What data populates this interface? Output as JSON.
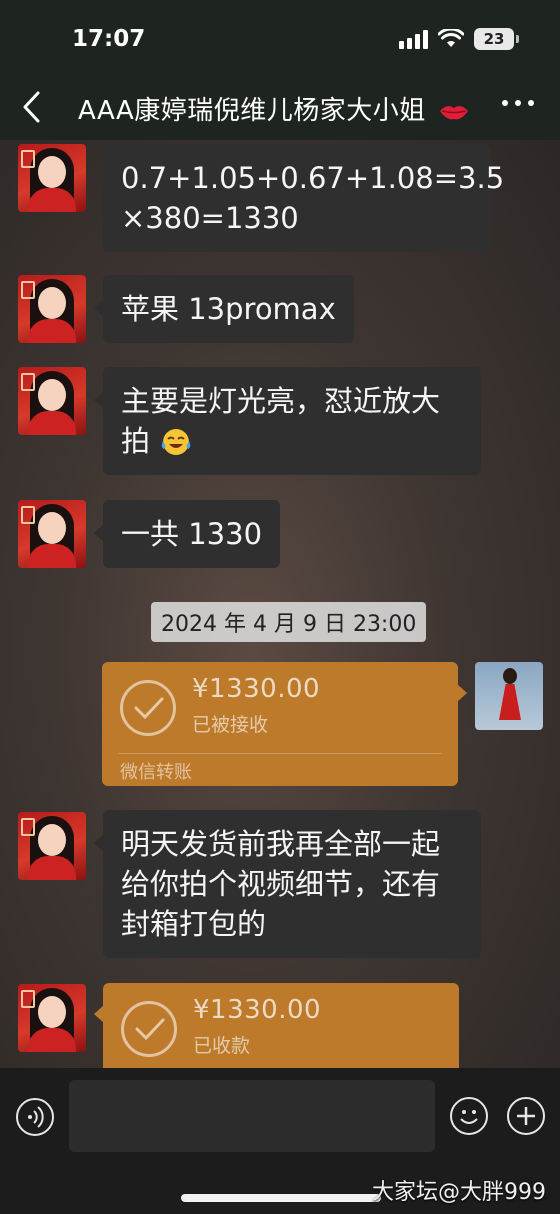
{
  "status": {
    "time": "17:07",
    "battery": "23"
  },
  "header": {
    "title": "AAA康婷瑞倪维儿杨家大小姐"
  },
  "messages": [
    {
      "line1": "0.7+1.05+0.67+1.08=3.5",
      "line2": "×380=1330"
    },
    {
      "line1": "苹果 13promax"
    },
    {
      "line1": "主要是灯光亮，怼近放大",
      "line2": "拍"
    },
    {
      "line1": "一共 1330"
    },
    {
      "line1": "明天发货前我再全部一起",
      "line2": "给你拍个视频细节，还有",
      "line3": "封箱打包的"
    }
  ],
  "time_separator": "2024 年 4 月 9 日 23:00",
  "transfers": [
    {
      "amount": "¥1330.00",
      "status": "已被接收",
      "footer": "微信转账"
    },
    {
      "amount": "¥1330.00",
      "status": "已收款"
    }
  ],
  "watermark": "大家坛@大胖999",
  "colors": {
    "bubble": "#2f2f2f",
    "transfer": "#bd7a2a",
    "header": "#1e2520"
  }
}
